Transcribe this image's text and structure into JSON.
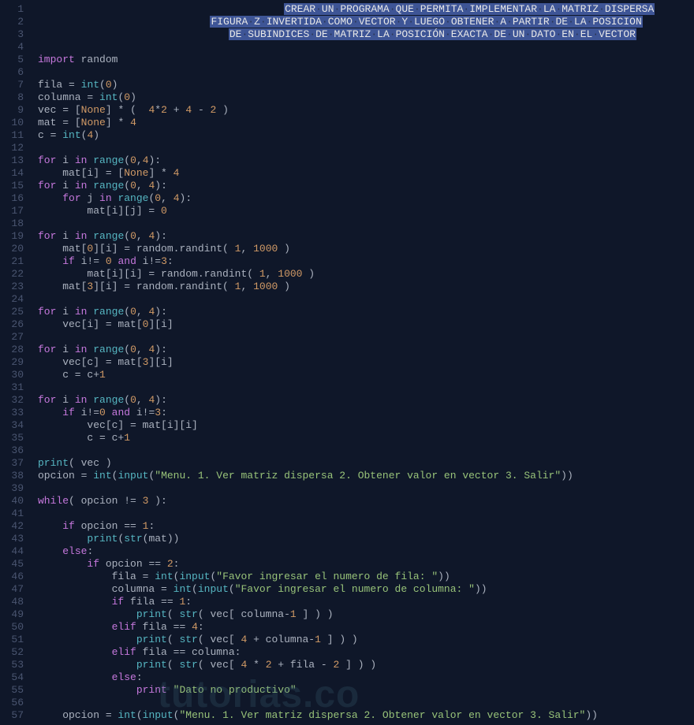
{
  "watermark": "tutorias.co",
  "colors": {
    "bg": "#0f1729",
    "selection": "#3e5596",
    "keyword": "#c678dd",
    "builtin": "#56b6c2",
    "number": "#d19a66",
    "string": "#98c379",
    "ident": "#abb2bf",
    "gutter": "#4a5570"
  },
  "gutter": [
    "1",
    "2",
    "3",
    "4",
    "5",
    "6",
    "7",
    "8",
    "9",
    "10",
    "11",
    "12",
    "13",
    "14",
    "15",
    "16",
    "17",
    "18",
    "19",
    "20",
    "21",
    "22",
    "23",
    "24",
    "25",
    "26",
    "27",
    "28",
    "29",
    "30",
    "31",
    "32",
    "33",
    "34",
    "35",
    "36",
    "37",
    "38",
    "39",
    "40",
    "41",
    "42",
    "43",
    "44",
    "45",
    "46",
    "47",
    "48",
    "49",
    "50",
    "51",
    "52",
    "53",
    "54",
    "55",
    "56",
    "57"
  ],
  "code_lines": {
    "l1": "                                  CREAR UN PROGRAMA QUE PERMITA IMPLEMENTAR LA MATRIZ DISPERSA",
    "l2": "                FIGURA Z INVERTIDA COMO VECTOR Y LUEGO OBTENER A PARTIR DE LA POSICION",
    "l3": "                 DE SUBINDICES DE MATRIZ LA POSICIÓN EXACTA DE UN DATO EN EL VECTOR",
    "l5_kw": "import",
    "l5_mod": "random",
    "l7": "fila = int(0)",
    "l8": "columna = int(0)",
    "l9": "vec = [None] * (  4*2 + 4 - 2 )",
    "l10": "mat = [None] * 4",
    "l11": "c = int(4)",
    "l13": "for i in range(0,4):",
    "l14": "    mat[i] = [None] * 4",
    "l15": "for i in range(0, 4):",
    "l16": "    for j in range(0, 4):",
    "l17": "        mat[i][j] = 0",
    "l19": "for i in range(0, 4):",
    "l20": "    mat[0][i] = random.randint( 1, 1000 )",
    "l21": "    if i!= 0 and i!=3:",
    "l22": "        mat[i][i] = random.randint( 1, 1000 )",
    "l23": "    mat[3][i] = random.randint( 1, 1000 )",
    "l25": "for i in range(0, 4):",
    "l26": "    vec[i] = mat[0][i]",
    "l28": "for i in range(0, 4):",
    "l29": "    vec[c] = mat[3][i]",
    "l30": "    c = c+1",
    "l32": "for i in range(0, 4):",
    "l33": "    if i!=0 and i!=3:",
    "l34": "        vec[c] = mat[i][i]",
    "l35": "        c = c+1",
    "l37": "print( vec )",
    "l38": "opcion = int(input(\"Menu. 1. Ver matriz dispersa 2. Obtener valor en vector 3. Salir\"))",
    "l38_str": "\"Menu. 1. Ver matriz dispersa 2. Obtener valor en vector 3. Salir\"",
    "l40": "while( opcion != 3 ):",
    "l42": "    if opcion == 1:",
    "l43": "        print(str(mat))",
    "l44": "    else:",
    "l45": "        if opcion == 2:",
    "l46": "            fila = int(input(\"Favor ingresar el numero de fila: \"))",
    "l46_str": "\"Favor ingresar el numero de fila: \"",
    "l47": "            columna = int(input(\"Favor ingresar el numero de columna: \"))",
    "l47_str": "\"Favor ingresar el numero de columna: \"",
    "l48": "            if fila == 1:",
    "l49": "                print( str( vec[ columna-1 ] ) )",
    "l50": "            elif fila == 4:",
    "l51": "                print( str( vec[ 4 + columna-1 ] ) )",
    "l52": "            elif fila == columna:",
    "l53": "                print( str( vec[ 4 * 2 + fila - 2 ] ) )",
    "l54": "            else:",
    "l55": "                print \"Dato no productivo\"",
    "l55_str": "\"Dato no productivo\"",
    "l57": "    opcion = int(input(\"Menu. 1. Ver matriz dispersa 2. Obtener valor en vector 3. Salir\"))",
    "l57_str": "\"Menu. 1. Ver matriz dispersa 2. Obtener valor en vector 3. Salir\""
  }
}
